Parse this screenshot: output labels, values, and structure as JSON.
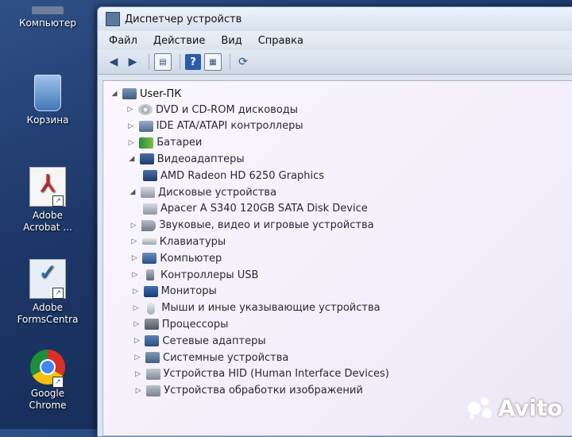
{
  "desktop": {
    "icons": [
      {
        "label": "Компьютер"
      },
      {
        "label": "Корзина"
      },
      {
        "label_line1": "Adobe",
        "label_line2": "Acrobat ..."
      },
      {
        "label_line1": "Adobe",
        "label_line2": "FormsCentra"
      },
      {
        "label_line1": "Google",
        "label_line2": "Chrome"
      }
    ]
  },
  "window": {
    "title": "Диспетчер устройств",
    "menu": [
      "Файл",
      "Действие",
      "Вид",
      "Справка"
    ],
    "toolbar": {
      "icons": [
        "back-arrow-icon",
        "forward-arrow-icon",
        "properties-icon",
        "help-icon",
        "view-icon",
        "scan-hardware-icon"
      ],
      "help_glyph": "?"
    }
  },
  "tree": {
    "root": "User-ПК",
    "items": [
      {
        "label": "DVD и CD-ROM дисководы",
        "expanded": false,
        "icon": "dvd-drive-icon"
      },
      {
        "label": "IDE ATA/ATAPI контроллеры",
        "expanded": false,
        "icon": "ide-controller-icon"
      },
      {
        "label": "Батареи",
        "expanded": false,
        "icon": "battery-icon"
      },
      {
        "label": "Видеоадаптеры",
        "expanded": true,
        "icon": "display-adapter-icon"
      },
      {
        "label": "AMD Radeon HD 6250 Graphics",
        "child": true,
        "icon": "display-adapter-icon"
      },
      {
        "label": "Дисковые устройства",
        "expanded": true,
        "icon": "disk-drive-icon"
      },
      {
        "label": "Apacer A S340 120GB SATA Disk Device",
        "child": true,
        "icon": "disk-drive-icon"
      },
      {
        "label": "Звуковые, видео и игровые устройства",
        "expanded": false,
        "icon": "sound-icon"
      },
      {
        "label": "Клавиатуры",
        "expanded": false,
        "icon": "keyboard-icon"
      },
      {
        "label": "Компьютер",
        "expanded": false,
        "icon": "computer-icon"
      },
      {
        "label": "Контроллеры USB",
        "expanded": false,
        "icon": "usb-icon"
      },
      {
        "label": "Мониторы",
        "expanded": false,
        "icon": "monitor-icon"
      },
      {
        "label": "Мыши и иные указывающие устройства",
        "expanded": false,
        "icon": "mouse-icon"
      },
      {
        "label": "Процессоры",
        "expanded": false,
        "icon": "processor-icon"
      },
      {
        "label": "Сетевые адаптеры",
        "expanded": false,
        "icon": "network-adapter-icon"
      },
      {
        "label": "Системные устройства",
        "expanded": false,
        "icon": "system-devices-icon"
      },
      {
        "label": "Устройства HID (Human Interface Devices)",
        "expanded": false,
        "icon": "hid-icon"
      },
      {
        "label": "Устройства обработки изображений",
        "expanded": false,
        "icon": "imaging-devices-icon"
      }
    ]
  },
  "watermark": "Avito"
}
